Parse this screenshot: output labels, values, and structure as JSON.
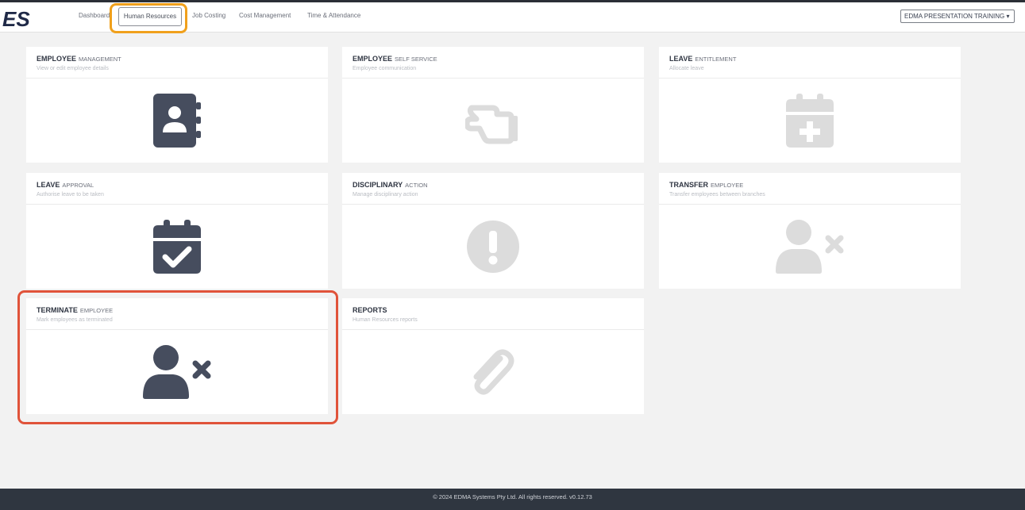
{
  "header": {
    "logo_text": "ES",
    "nav": [
      {
        "label": "Dashboard"
      },
      {
        "label": "Human Resources"
      },
      {
        "label": "Job Costing"
      },
      {
        "label": "Cost Management"
      },
      {
        "label": "Time & Attendance"
      }
    ],
    "company_select": "EDMA PRESENTATION TRAINING ▾"
  },
  "cards": [
    {
      "title": "EMPLOYEE",
      "subtitle": "MANAGEMENT",
      "description": "View or edit employee details",
      "icon": "address-book-icon",
      "enabled": true
    },
    {
      "title": "EMPLOYEE",
      "subtitle": "SELF SERVICE",
      "description": "Employee communication",
      "icon": "hand-pointing-icon",
      "enabled": false
    },
    {
      "title": "LEAVE",
      "subtitle": "ENTITLEMENT",
      "description": "Allocate leave",
      "icon": "calendar-plus-icon",
      "enabled": false
    },
    {
      "title": "LEAVE",
      "subtitle": "APPROVAL",
      "description": "Authorise leave to be taken",
      "icon": "calendar-check-icon",
      "enabled": true
    },
    {
      "title": "DISCIPLINARY",
      "subtitle": "ACTION",
      "description": "Manage disciplinary action",
      "icon": "exclamation-circle-icon",
      "enabled": false
    },
    {
      "title": "TRANSFER",
      "subtitle": "EMPLOYEE",
      "description": "Transfer employees between branches",
      "icon": "user-remove-icon",
      "enabled": false
    },
    {
      "title": "TERMINATE",
      "subtitle": "EMPLOYEE",
      "description": "Mark employees as terminated",
      "icon": "user-remove-icon",
      "enabled": true
    },
    {
      "title": "REPORTS",
      "subtitle": "",
      "description": "Human Resources reports",
      "icon": "paperclip-icon",
      "enabled": false
    }
  ],
  "colors": {
    "icon_enabled": "#464d5e",
    "icon_disabled": "#dcdcdc",
    "nav_highlight": "#f0a01c",
    "card_highlight": "#e0533a"
  },
  "footer": {
    "text": "© 2024 EDMA Systems Pty Ltd. All rights reserved. v0.12.73"
  }
}
